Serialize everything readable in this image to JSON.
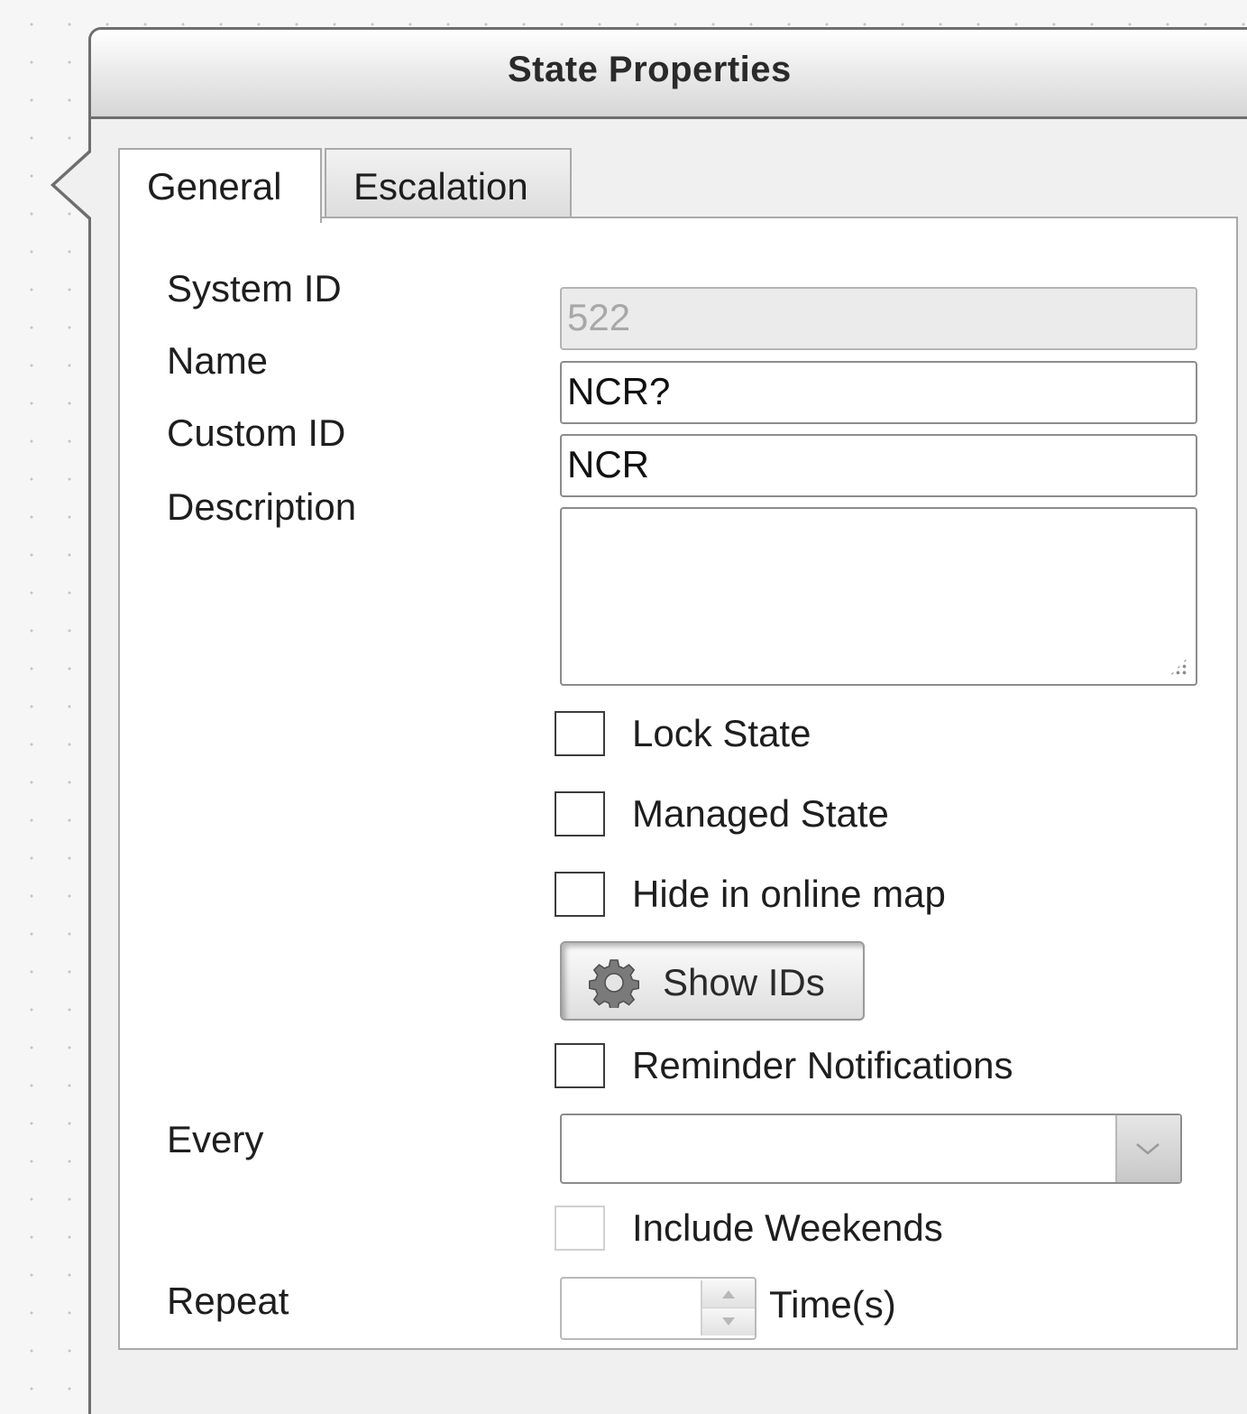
{
  "dialog": {
    "title": "State Properties"
  },
  "tabs": [
    {
      "label": "General",
      "active": true
    },
    {
      "label": "Escalation",
      "active": false
    }
  ],
  "general": {
    "system_id": {
      "label": "System ID",
      "value": "522",
      "disabled": true
    },
    "name": {
      "label": "Name",
      "value": "NCR?"
    },
    "custom_id": {
      "label": "Custom ID",
      "value": "NCR"
    },
    "description": {
      "label": "Description",
      "value": ""
    },
    "lock_state": {
      "label": "Lock State",
      "checked": false
    },
    "managed_state": {
      "label": "Managed State",
      "checked": false
    },
    "hide_in_online_map": {
      "label": "Hide in online map",
      "checked": false
    },
    "show_ids_button": {
      "label": "Show IDs",
      "icon": "gear-icon"
    },
    "reminder_notifications": {
      "label": "Reminder Notifications",
      "checked": false
    },
    "every": {
      "label": "Every",
      "value": "",
      "icon": "chevron-down-icon"
    },
    "include_weekends": {
      "label": "Include Weekends",
      "checked": false,
      "disabled": true
    },
    "repeat": {
      "label": "Repeat",
      "value": "",
      "unit": "Time(s)"
    }
  }
}
